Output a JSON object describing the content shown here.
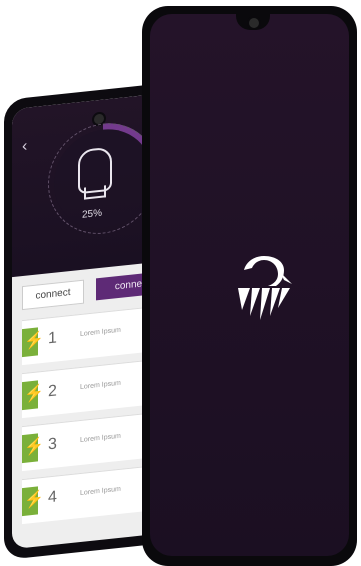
{
  "back_screen": {
    "back_icon": "chevron-left-icon",
    "bulb_icon": "lightbulb-icon",
    "progress_percent": 25,
    "percent_label": "25%",
    "tabs": [
      {
        "label": "connect"
      },
      {
        "label": "connec"
      }
    ],
    "list_items": [
      {
        "icon": "lightning-icon",
        "number": "1",
        "text": "Lorem Ipsum"
      },
      {
        "icon": "lightning-icon",
        "number": "2",
        "text": "Lorem Ipsum"
      },
      {
        "icon": "lightning-icon",
        "number": "3",
        "text": "Lorem Ipsum"
      },
      {
        "icon": "lightning-icon",
        "number": "4",
        "text": "Lorem Ipsum"
      }
    ],
    "colors": {
      "accent": "#5e2a76",
      "bolt": "#7ab03a",
      "header": "#1d1225"
    }
  },
  "front_screen": {
    "logo_icon": "bird-logo-icon",
    "colors": {
      "background": "#241329"
    }
  }
}
